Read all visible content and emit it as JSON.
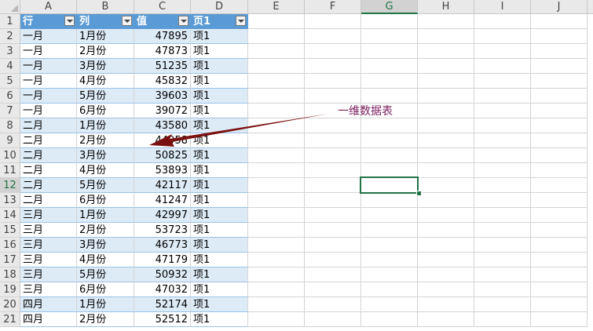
{
  "columns": [
    "A",
    "B",
    "C",
    "D",
    "E",
    "F",
    "G",
    "H",
    "I",
    "J"
  ],
  "selected_column": "G",
  "selected_row": 12,
  "table": {
    "headers": [
      "行",
      "列",
      "值",
      "页1"
    ],
    "rows": [
      [
        "一月",
        "1月份",
        "47895",
        "项1"
      ],
      [
        "一月",
        "2月份",
        "47873",
        "项1"
      ],
      [
        "一月",
        "3月份",
        "51235",
        "项1"
      ],
      [
        "一月",
        "4月份",
        "45832",
        "项1"
      ],
      [
        "一月",
        "5月份",
        "39603",
        "项1"
      ],
      [
        "一月",
        "6月份",
        "39072",
        "项1"
      ],
      [
        "二月",
        "1月份",
        "43580",
        "项1"
      ],
      [
        "二月",
        "2月份",
        "44958",
        "项1"
      ],
      [
        "二月",
        "3月份",
        "50825",
        "项1"
      ],
      [
        "二月",
        "4月份",
        "53893",
        "项1"
      ],
      [
        "二月",
        "5月份",
        "42117",
        "项1"
      ],
      [
        "二月",
        "6月份",
        "41247",
        "项1"
      ],
      [
        "三月",
        "1月份",
        "42997",
        "项1"
      ],
      [
        "三月",
        "2月份",
        "53723",
        "项1"
      ],
      [
        "三月",
        "3月份",
        "46773",
        "项1"
      ],
      [
        "三月",
        "4月份",
        "47179",
        "项1"
      ],
      [
        "三月",
        "5月份",
        "50932",
        "项1"
      ],
      [
        "三月",
        "6月份",
        "47032",
        "项1"
      ],
      [
        "四月",
        "1月份",
        "52174",
        "项1"
      ],
      [
        "四月",
        "2月份",
        "52512",
        "项1"
      ]
    ]
  },
  "annotation": {
    "text": "一维数据表"
  },
  "colors": {
    "header_fill": "#5b9bd5",
    "band_fill": "#ddebf7",
    "arrow": "#7b1010",
    "annotation_text": "#7a1c5c",
    "selection": "#217346"
  }
}
